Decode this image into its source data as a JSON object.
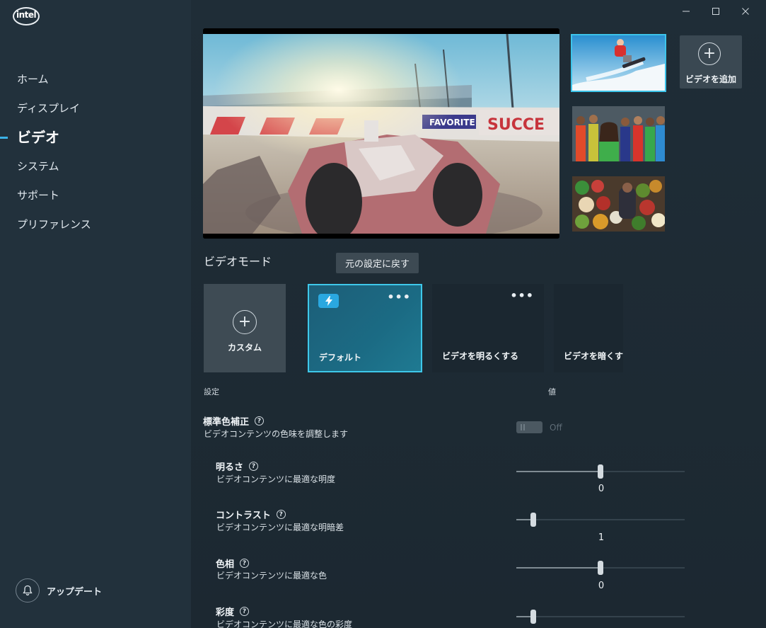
{
  "brand": {
    "logo_text": "intel"
  },
  "window_controls": {
    "minimize": "—",
    "maximize": "☐",
    "close": "✕"
  },
  "sidebar": {
    "items": [
      {
        "label": "ホーム"
      },
      {
        "label": "ディスプレイ"
      },
      {
        "label": "ビデオ",
        "active": true
      },
      {
        "label": "システム"
      },
      {
        "label": "サポート"
      },
      {
        "label": "プリファレンス"
      }
    ],
    "update_label": "アップデート"
  },
  "preview": {
    "selected_thumbnail": 1
  },
  "add_video_label": "ビデオを追加",
  "video_mode": {
    "title": "ビデオモード",
    "reset_tooltip": "元の設定に戻す",
    "cards": {
      "custom": "カスタム",
      "default": "デフォルト",
      "brighten": "ビデオを明るくする",
      "darken": "ビデオを暗くす"
    },
    "more_dots": "•••"
  },
  "settings": {
    "col_setting": "設定",
    "col_value": "値",
    "color_correction": {
      "name": "標準色補正",
      "desc": "ビデオコンテンツの色味を調整します",
      "toggle_label": "Off",
      "enabled": false
    },
    "brightness": {
      "name": "明るさ",
      "desc": "ビデオコンテンツに最適な明度",
      "value": "0",
      "level": 0.5
    },
    "contrast": {
      "name": "コントラスト",
      "desc": "ビデオコンテンツに最適な明暗差",
      "value": "1",
      "level": 0.1
    },
    "hue": {
      "name": "色相",
      "desc": "ビデオコンテンツに最適な色",
      "value": "0",
      "level": 0.5
    },
    "saturation": {
      "name": "彩度",
      "desc": "ビデオコンテンツに最適な色の彩度",
      "level": 0.1
    },
    "help_glyph": "?"
  },
  "accent_color": "#3ec8ea"
}
